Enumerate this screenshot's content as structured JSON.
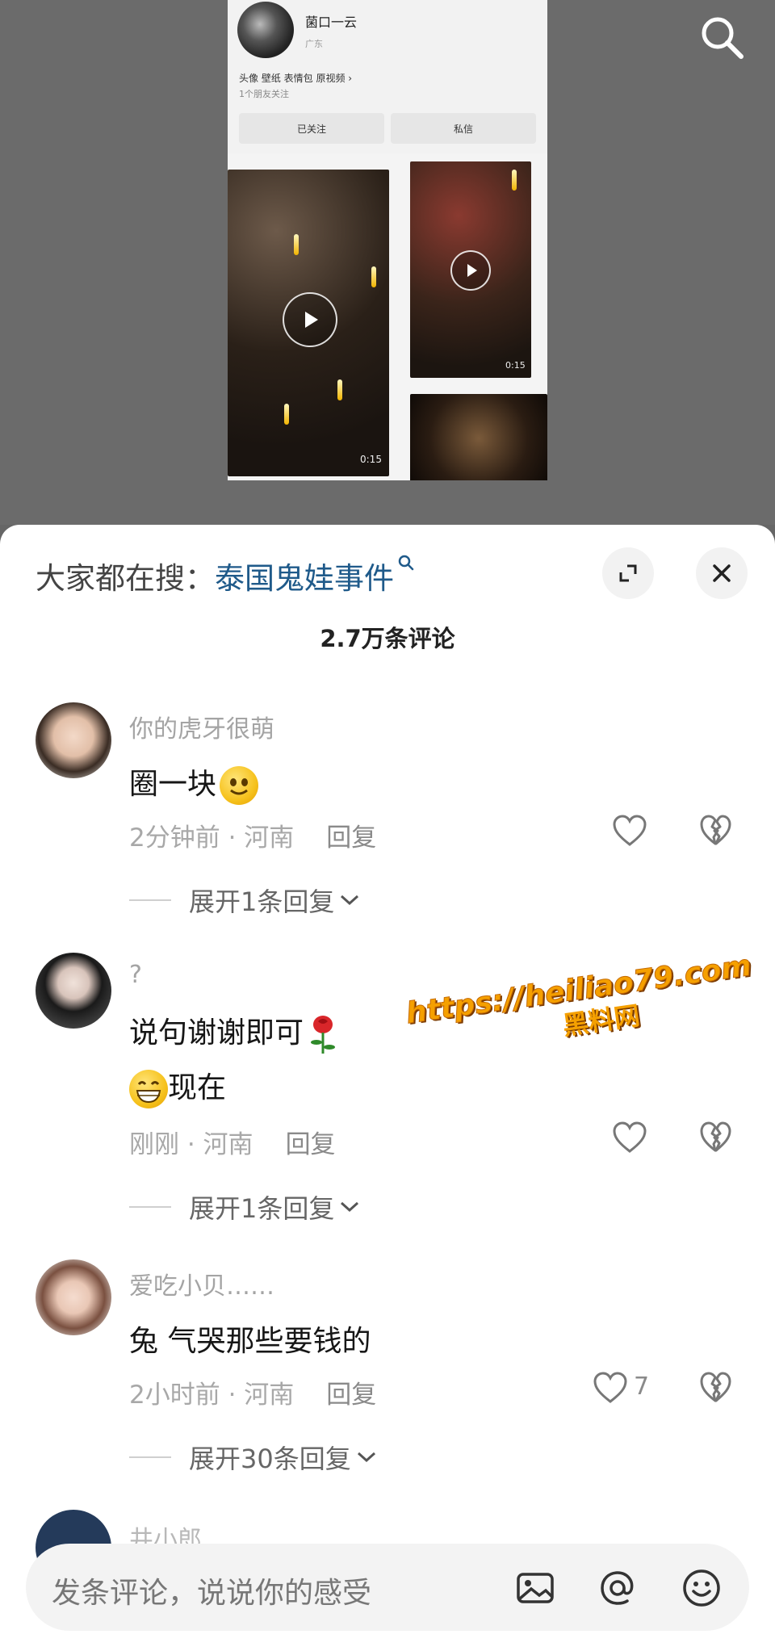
{
  "video_screenshot": {
    "profile_name": "菌口一云",
    "profile_region": "广东",
    "profile_tags": "头像 壁纸 表情包 原视频 ›",
    "profile_friends": "1个朋友关注",
    "follow_button": "已关注",
    "message_button": "私信",
    "durations": [
      "0:15",
      "0:15"
    ]
  },
  "hot_search": {
    "prefix": "大家都在搜：",
    "term": "泰国鬼娃事件"
  },
  "comment_count": "2.7万条评论",
  "comments": [
    {
      "user": "你的虎牙很萌",
      "text": "圈一块",
      "time_location": "2分钟前 · 河南",
      "reply_label": "回复",
      "likes": "",
      "expand": "展开1条回复"
    },
    {
      "user": "?",
      "text_line1": "说句谢谢即可",
      "text_line2": "现在",
      "time_location": "刚刚 · 河南",
      "reply_label": "回复",
      "likes": "",
      "expand": "展开1条回复"
    },
    {
      "user": "爱吃小贝……",
      "text": "兔 气哭那些要钱的",
      "time_location": "2小时前 · 河南",
      "reply_label": "回复",
      "likes": "7",
      "expand": "展开30条回复"
    },
    {
      "user": "井小郎"
    }
  ],
  "input": {
    "placeholder": "发条评论，说说你的感受"
  },
  "watermark": {
    "url": "https://heiliao79.com",
    "cn": "黑料网"
  },
  "colors": {
    "hot_term": "#1f5a8a",
    "watermark": "#f5a000"
  }
}
